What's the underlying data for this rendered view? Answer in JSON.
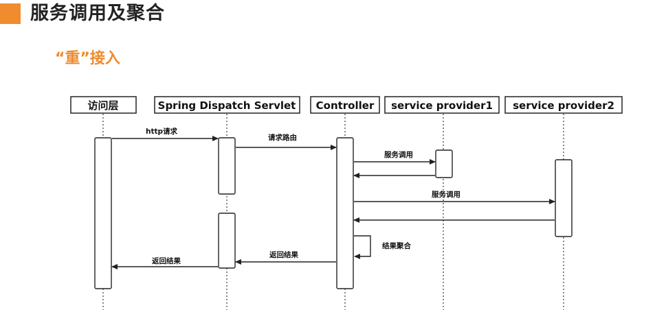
{
  "header": {
    "title": "服务调用及聚合",
    "accent_color": "#f08c2e"
  },
  "subtitle": "“重”接入",
  "participants": [
    "访问层",
    "Spring Dispatch Servlet",
    "Controller",
    "service provider1",
    "service provider2"
  ],
  "messages": [
    {
      "from": "访问层",
      "to": "Spring Dispatch Servlet",
      "label": "http请求",
      "style": "call"
    },
    {
      "from": "Spring Dispatch Servlet",
      "to": "Controller",
      "label": "请求路由",
      "style": "call"
    },
    {
      "from": "Controller",
      "to": "service provider1",
      "label": "服务调用",
      "style": "call"
    },
    {
      "from": "service provider1",
      "to": "Controller",
      "label": "",
      "style": "return"
    },
    {
      "from": "Controller",
      "to": "service provider2",
      "label": "服务调用",
      "style": "call"
    },
    {
      "from": "service provider2",
      "to": "Controller",
      "label": "",
      "style": "return"
    },
    {
      "from": "Controller",
      "to": "Controller",
      "label": "结果聚合",
      "style": "self"
    },
    {
      "from": "Controller",
      "to": "Spring Dispatch Servlet",
      "label": "返回结果",
      "style": "return"
    },
    {
      "from": "Spring Dispatch Servlet",
      "to": "访问层",
      "label": "返回结果",
      "style": "return"
    }
  ]
}
